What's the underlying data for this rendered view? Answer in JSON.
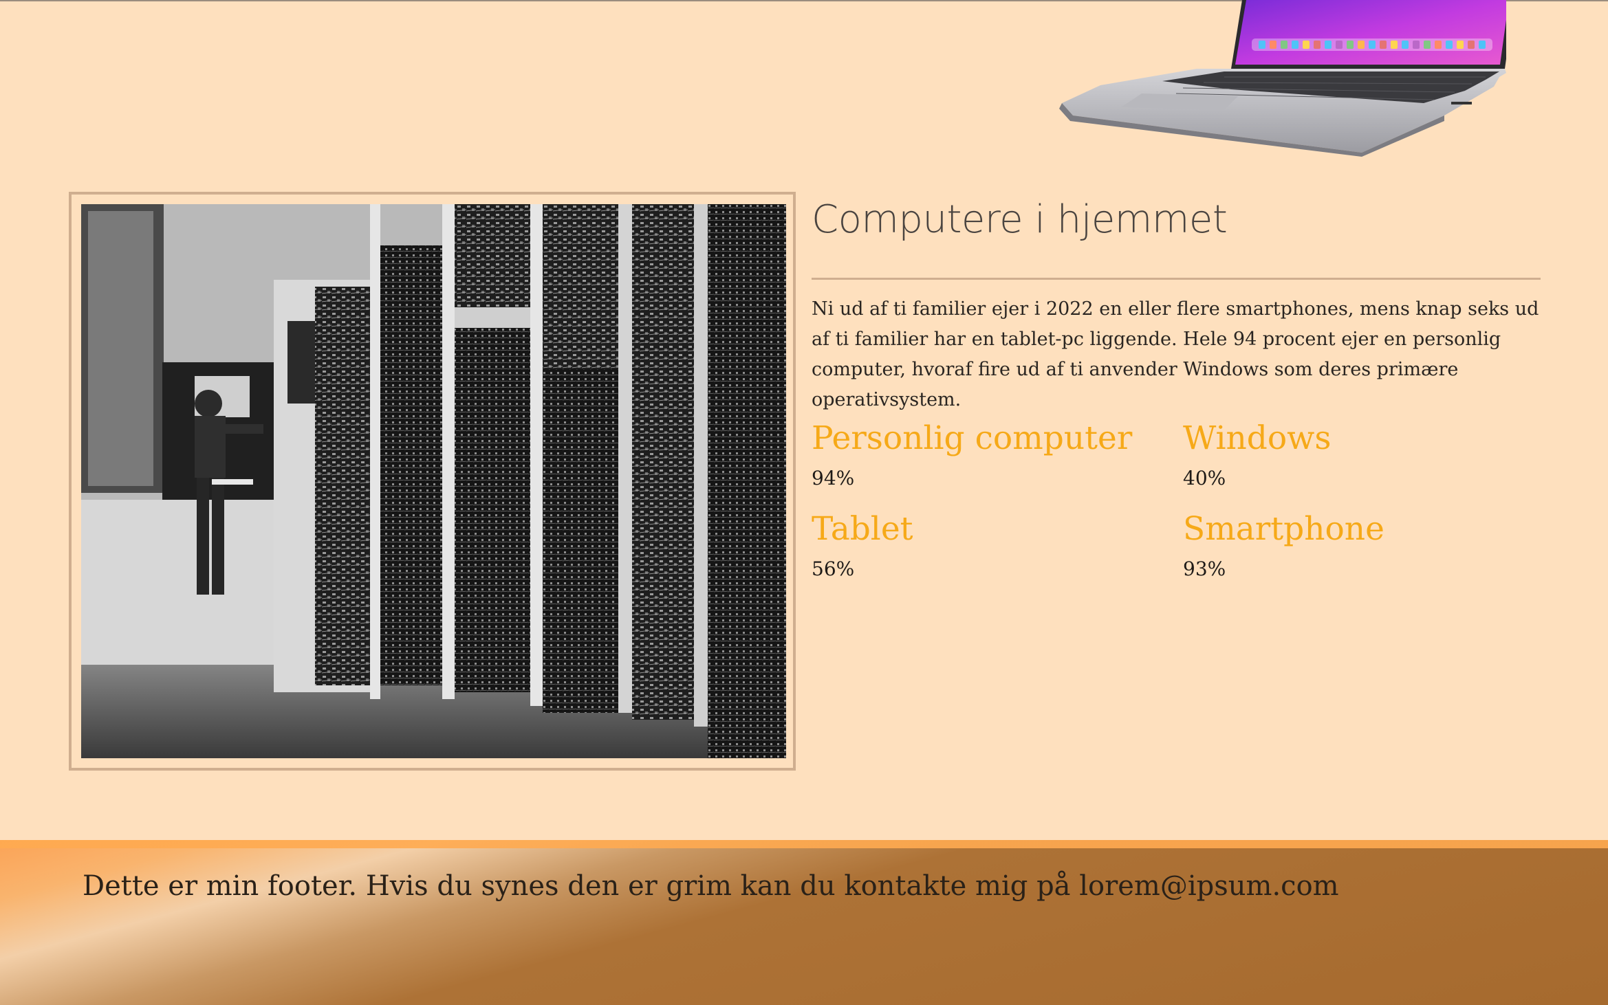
{
  "article": {
    "title": "Computere i hjemmet",
    "intro": "Ni ud af ti familier ejer i 2022 en eller flere smartphones, mens knap seks ud af ti familier har en tablet-pc liggende. Hele 94 procent ejer en personlig computer, hvoraf fire ud af ti anvender Windows som deres primære operativsystem."
  },
  "stats": [
    {
      "label": "Personlig computer",
      "value": "94%"
    },
    {
      "label": "Windows",
      "value": "40%"
    },
    {
      "label": "Tablet",
      "value": "56%"
    },
    {
      "label": "Smartphone",
      "value": "93%"
    }
  ],
  "images": {
    "hero": "vintage-mainframe-computer-photo",
    "laptop": "laptop-illustration"
  },
  "colors": {
    "background": "#fee0be",
    "accent": "#f6a918",
    "frame": "#cfae8f"
  },
  "footer": {
    "text": "Dette er min footer. Hvis du synes den er grim kan du kontakte mig på lorem@ipsum.com"
  }
}
